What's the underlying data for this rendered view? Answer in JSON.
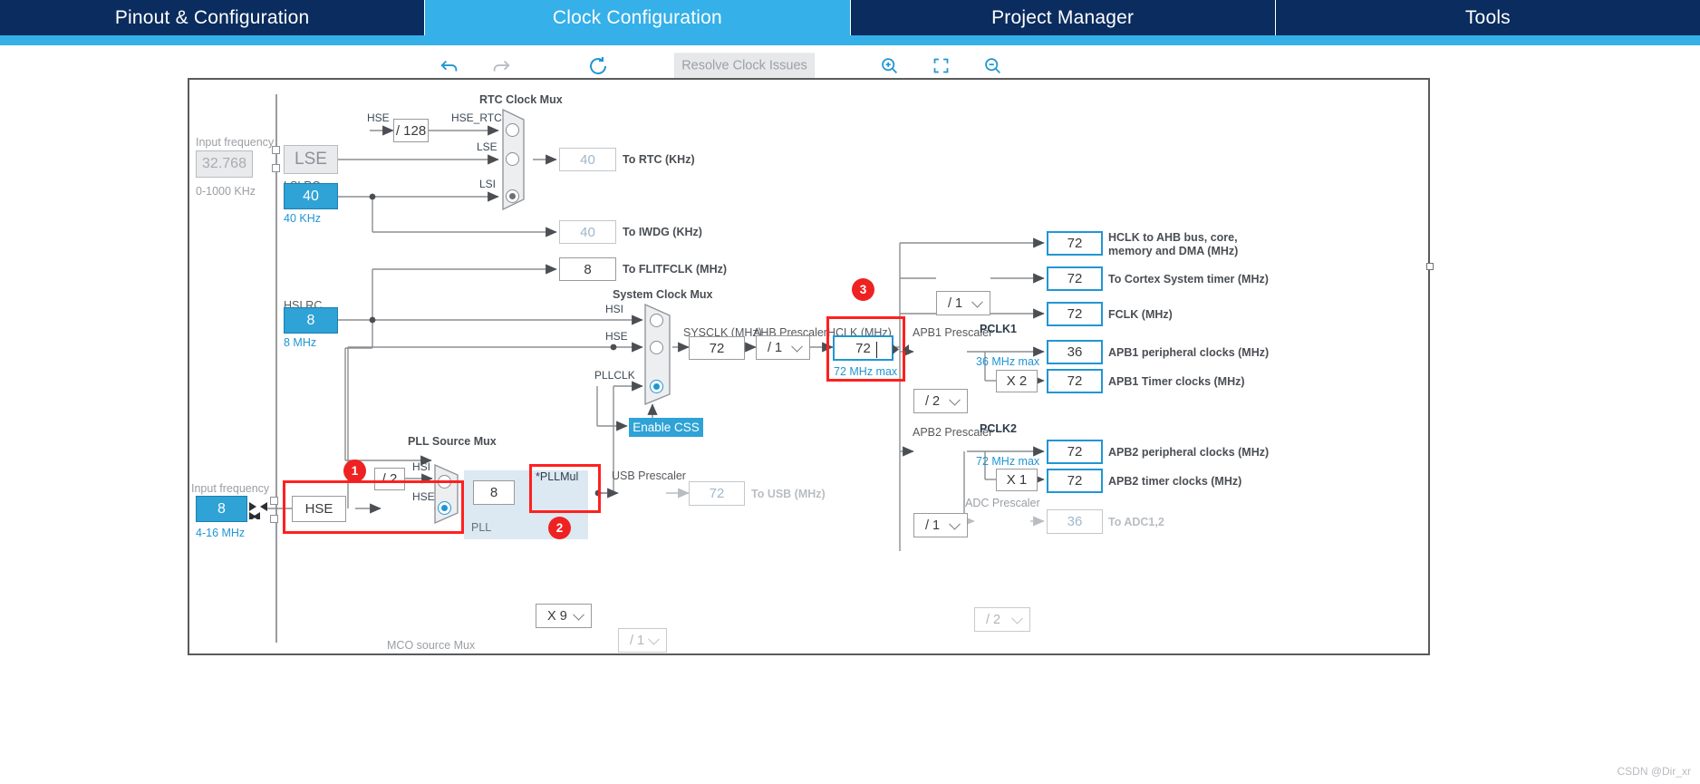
{
  "tabs": [
    {
      "label": "Pinout & Configuration",
      "active": false
    },
    {
      "label": "Clock Configuration",
      "active": true
    },
    {
      "label": "Project Manager",
      "active": false
    },
    {
      "label": "Tools",
      "active": false
    }
  ],
  "toolbar": {
    "undo_icon": "undo-icon",
    "redo_icon": "redo-icon",
    "reset_icon": "reset-icon",
    "resolve_label": "Resolve Clock Issues",
    "zoom_in_icon": "zoom-in-icon",
    "fit_icon": "fit-to-screen-icon",
    "zoom_out_icon": "zoom-out-icon"
  },
  "diagram": {
    "lse": {
      "input_frequency_label": "Input frequency",
      "value": "32.768",
      "range": "0-1000 KHz",
      "name": "LSE"
    },
    "lsi": {
      "label": "LSI RC",
      "value": "40",
      "unit": "40 KHz"
    },
    "hsi": {
      "label": "HSI RC",
      "value": "8",
      "unit": "8 MHz"
    },
    "hse": {
      "input_frequency_label": "Input frequency",
      "value": "8",
      "range": "4-16 MHz",
      "name": "HSE"
    },
    "hse_rtc_div": "/ 128",
    "signals": {
      "hse": "HSE",
      "hse_rtc": "HSE_RTC",
      "lse": "LSE",
      "lsi": "LSI",
      "hsi": "HSI",
      "pllclk": "PLLCLK",
      "pclk1": "PCLK1",
      "pclk2": "PCLK2"
    },
    "rtc_clock_mux": {
      "title": "RTC Clock Mux",
      "inputs": [
        "HSE_RTC",
        "LSE",
        "LSI"
      ],
      "selected_index": 2
    },
    "system_clock_mux": {
      "title": "System Clock Mux",
      "inputs": [
        "HSI",
        "HSE",
        "PLLCLK"
      ],
      "selected_index": 2
    },
    "pll_source_mux": {
      "title": "PLL Source Mux",
      "inputs": [
        "HSI",
        "HSE"
      ],
      "selected_index": 1
    },
    "mco_source_mux": {
      "title": "MCO source Mux"
    },
    "pll": {
      "region_label": "PLL",
      "input_value": "8",
      "mul_label": "*PLLMul",
      "mul_value": "X 9"
    },
    "hsi_div2": "/ 2",
    "hse_div": "/ 1",
    "enable_css": "Enable CSS",
    "outputs": {
      "to_rtc": {
        "value": "40",
        "label": "To RTC (KHz)"
      },
      "to_iwdg": {
        "value": "40",
        "label": "To IWDG (KHz)"
      },
      "to_flitfclk": {
        "value": "8",
        "label": "To FLITFCLK (MHz)"
      },
      "to_usb": {
        "value": "72",
        "label": "To USB (MHz)"
      },
      "to_adc": {
        "value": "36",
        "label": "To ADC1,2"
      }
    },
    "sysclk": {
      "label": "SYSCLK (MHz)",
      "value": "72"
    },
    "ahb_prescaler": {
      "label": "AHB Prescaler",
      "value": "/ 1"
    },
    "hclk": {
      "label": "HCLK (MHz)",
      "value": "72",
      "max": "72 MHz max"
    },
    "cortex_prescaler": {
      "value": "/ 1"
    },
    "usb_prescaler": {
      "label": "USB Prescaler",
      "value": "/ 1"
    },
    "apb1_prescaler": {
      "label": "APB1 Prescaler",
      "value": "/ 2",
      "max": "36 MHz max",
      "timer_mul": "X 2"
    },
    "apb2_prescaler": {
      "label": "APB2 Prescaler",
      "value": "/ 1",
      "max": "72 MHz max",
      "timer_mul": "X 1"
    },
    "adc_prescaler": {
      "label": "ADC Prescaler",
      "value": "/ 2"
    },
    "hclk_outputs": [
      {
        "value": "72",
        "label": "HCLK to AHB bus, core,",
        "label2": "memory and DMA (MHz)"
      },
      {
        "value": "72",
        "label": "To Cortex System timer (MHz)"
      },
      {
        "value": "72",
        "label": "FCLK (MHz)"
      }
    ],
    "apb1_outputs": [
      {
        "value": "36",
        "label": "APB1 peripheral clocks (MHz)"
      },
      {
        "value": "72",
        "label": "APB1 Timer clocks (MHz)"
      }
    ],
    "apb2_outputs": [
      {
        "value": "72",
        "label": "APB2 peripheral clocks (MHz)"
      },
      {
        "value": "72",
        "label": "APB2 timer clocks (MHz)"
      }
    ],
    "annotations": [
      {
        "number": "1"
      },
      {
        "number": "2"
      },
      {
        "number": "3"
      }
    ]
  },
  "watermark": "CSDN @Dir_xr",
  "colors": {
    "tab_bg": "#0a2c5e",
    "tab_active": "#35b0e8",
    "accent_blue": "#2196d3",
    "cyan_fill": "#2fa2d6",
    "annotation_red": "#ee2222"
  }
}
